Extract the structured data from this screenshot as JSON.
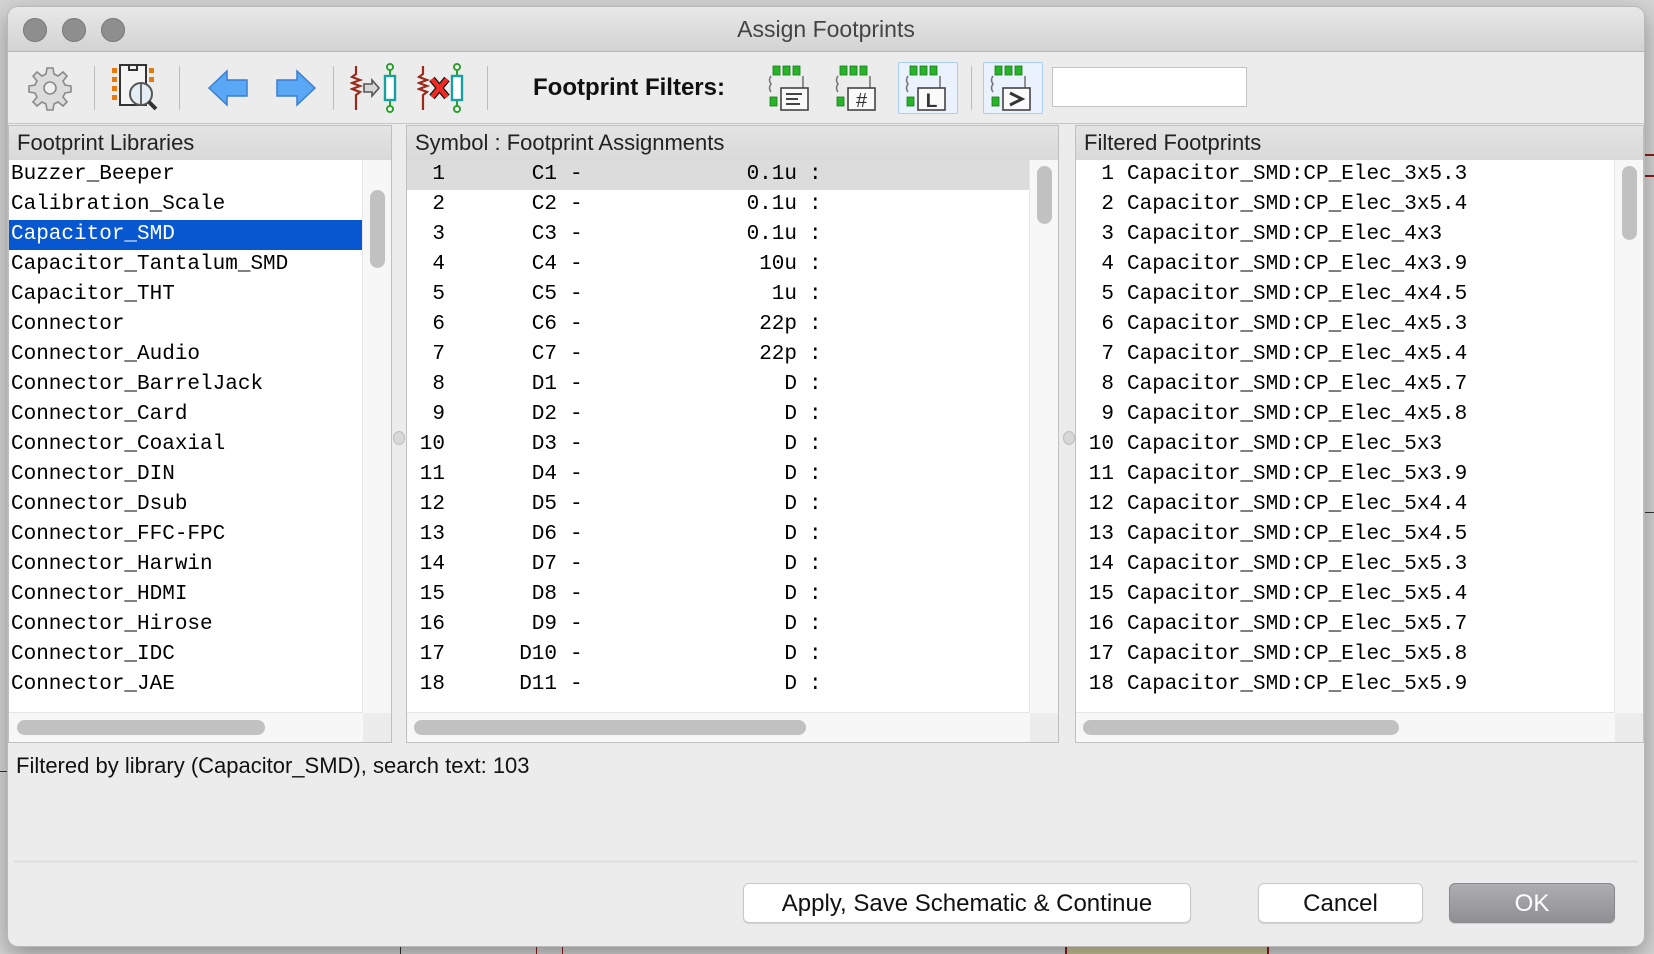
{
  "window": {
    "title": "Assign Footprints"
  },
  "toolbar": {
    "buttons": [
      {
        "name": "preferences",
        "icon": "gear-icon"
      },
      {
        "name": "view-library",
        "icon": "footprint-viewer-icon"
      },
      {
        "name": "previous-unassigned",
        "icon": "arrow-left-icon"
      },
      {
        "name": "next-unassigned",
        "icon": "arrow-right-icon"
      },
      {
        "name": "associate",
        "icon": "associate-icon"
      },
      {
        "name": "delete-all-assignments",
        "icon": "delete-association-icon"
      }
    ],
    "filters_label": "Footprint Filters:",
    "filter_buttons": [
      {
        "name": "filter-keywords",
        "glyph": "≡",
        "toggled": false
      },
      {
        "name": "filter-pin-count",
        "glyph": "#",
        "toggled": false
      },
      {
        "name": "filter-library",
        "glyph": "L",
        "toggled": true
      },
      {
        "name": "filter-search-text",
        "glyph": ">",
        "toggled": true
      }
    ],
    "search_value": "",
    "colors": {
      "accent": "#0758d0",
      "pad_green": "#2bb52b"
    }
  },
  "libraries": {
    "header": "Footprint Libraries",
    "selected_index": 2,
    "items": [
      "Buzzer_Beeper",
      "Calibration_Scale",
      "Capacitor_SMD",
      "Capacitor_Tantalum_SMD",
      "Capacitor_THT",
      "Connector",
      "Connector_Audio",
      "Connector_BarrelJack",
      "Connector_Card",
      "Connector_Coaxial",
      "Connector_DIN",
      "Connector_Dsub",
      "Connector_FFC-FPC",
      "Connector_Harwin",
      "Connector_HDMI",
      "Connector_Hirose",
      "Connector_IDC",
      "Connector_JAE"
    ]
  },
  "assignments": {
    "header": "Symbol : Footprint Assignments",
    "current_index": 0,
    "rows": [
      {
        "num": "1",
        "ref": "C1",
        "value": "0.1u",
        "footprint": ""
      },
      {
        "num": "2",
        "ref": "C2",
        "value": "0.1u",
        "footprint": ""
      },
      {
        "num": "3",
        "ref": "C3",
        "value": "0.1u",
        "footprint": ""
      },
      {
        "num": "4",
        "ref": "C4",
        "value": "10u",
        "footprint": ""
      },
      {
        "num": "5",
        "ref": "C5",
        "value": "1u",
        "footprint": ""
      },
      {
        "num": "6",
        "ref": "C6",
        "value": "22p",
        "footprint": ""
      },
      {
        "num": "7",
        "ref": "C7",
        "value": "22p",
        "footprint": ""
      },
      {
        "num": "8",
        "ref": "D1",
        "value": "D",
        "footprint": ""
      },
      {
        "num": "9",
        "ref": "D2",
        "value": "D",
        "footprint": ""
      },
      {
        "num": "10",
        "ref": "D3",
        "value": "D",
        "footprint": ""
      },
      {
        "num": "11",
        "ref": "D4",
        "value": "D",
        "footprint": ""
      },
      {
        "num": "12",
        "ref": "D5",
        "value": "D",
        "footprint": ""
      },
      {
        "num": "13",
        "ref": "D6",
        "value": "D",
        "footprint": ""
      },
      {
        "num": "14",
        "ref": "D7",
        "value": "D",
        "footprint": ""
      },
      {
        "num": "15",
        "ref": "D8",
        "value": "D",
        "footprint": ""
      },
      {
        "num": "16",
        "ref": "D9",
        "value": "D",
        "footprint": ""
      },
      {
        "num": "17",
        "ref": "D10",
        "value": "D",
        "footprint": ""
      },
      {
        "num": "18",
        "ref": "D11",
        "value": "D",
        "footprint": ""
      }
    ]
  },
  "footprints": {
    "header": "Filtered Footprints",
    "items": [
      {
        "num": "1",
        "name": "Capacitor_SMD:CP_Elec_3x5.3"
      },
      {
        "num": "2",
        "name": "Capacitor_SMD:CP_Elec_3x5.4"
      },
      {
        "num": "3",
        "name": "Capacitor_SMD:CP_Elec_4x3"
      },
      {
        "num": "4",
        "name": "Capacitor_SMD:CP_Elec_4x3.9"
      },
      {
        "num": "5",
        "name": "Capacitor_SMD:CP_Elec_4x4.5"
      },
      {
        "num": "6",
        "name": "Capacitor_SMD:CP_Elec_4x5.3"
      },
      {
        "num": "7",
        "name": "Capacitor_SMD:CP_Elec_4x5.4"
      },
      {
        "num": "8",
        "name": "Capacitor_SMD:CP_Elec_4x5.7"
      },
      {
        "num": "9",
        "name": "Capacitor_SMD:CP_Elec_4x5.8"
      },
      {
        "num": "10",
        "name": "Capacitor_SMD:CP_Elec_5x3"
      },
      {
        "num": "11",
        "name": "Capacitor_SMD:CP_Elec_5x3.9"
      },
      {
        "num": "12",
        "name": "Capacitor_SMD:CP_Elec_5x4.4"
      },
      {
        "num": "13",
        "name": "Capacitor_SMD:CP_Elec_5x4.5"
      },
      {
        "num": "14",
        "name": "Capacitor_SMD:CP_Elec_5x5.3"
      },
      {
        "num": "15",
        "name": "Capacitor_SMD:CP_Elec_5x5.4"
      },
      {
        "num": "16",
        "name": "Capacitor_SMD:CP_Elec_5x5.7"
      },
      {
        "num": "17",
        "name": "Capacitor_SMD:CP_Elec_5x5.8"
      },
      {
        "num": "18",
        "name": "Capacitor_SMD:CP_Elec_5x5.9"
      }
    ]
  },
  "status": {
    "text": "Filtered by library (Capacitor_SMD), search text: 103"
  },
  "buttons": {
    "apply_label": "Apply, Save Schematic & Continue",
    "cancel_label": "Cancel",
    "ok_label": "OK"
  }
}
